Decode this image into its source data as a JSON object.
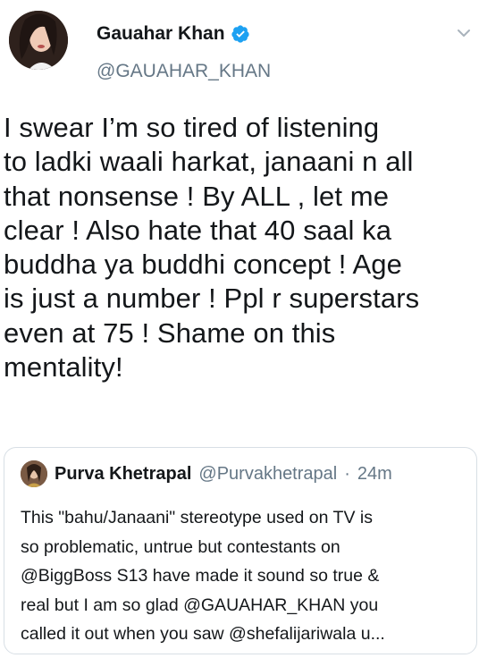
{
  "author": {
    "name": "Gauahar Khan",
    "handle": "@GAUAHAR_KHAN",
    "verified": true
  },
  "tweet": {
    "lines": [
      "I swear I’m so tired of listening",
      "to ladki waali harkat, janaani n all",
      "that nonsense ! By ALL , let me",
      "clear ! Also hate that 40 saal ka",
      "buddha ya buddhi concept ! Age",
      "is just a number ! Ppl r superstars",
      "even at 75 ! Shame on this",
      "mentality!"
    ]
  },
  "quoted_tweet": {
    "name": "Purva Khetrapal",
    "handle": "@Purvakhetrapal",
    "separator": "·",
    "time": "24m",
    "lines": [
      "This \"bahu/Janaani\" stereotype used on TV is",
      "so problematic, untrue but contestants on",
      "@BiggBoss S13 have made it sound so true &",
      "real but I am so glad @GAUAHAR_KHAN you",
      "called it out when you saw @shefalijariwala u..."
    ]
  },
  "icons": {
    "verified": "verified-badge-icon",
    "menu": "chevron-down-icon"
  },
  "colors": {
    "text": "#14171a",
    "secondary": "#657786",
    "verified_blue": "#1da1f2",
    "border": "#d8dfe5"
  }
}
